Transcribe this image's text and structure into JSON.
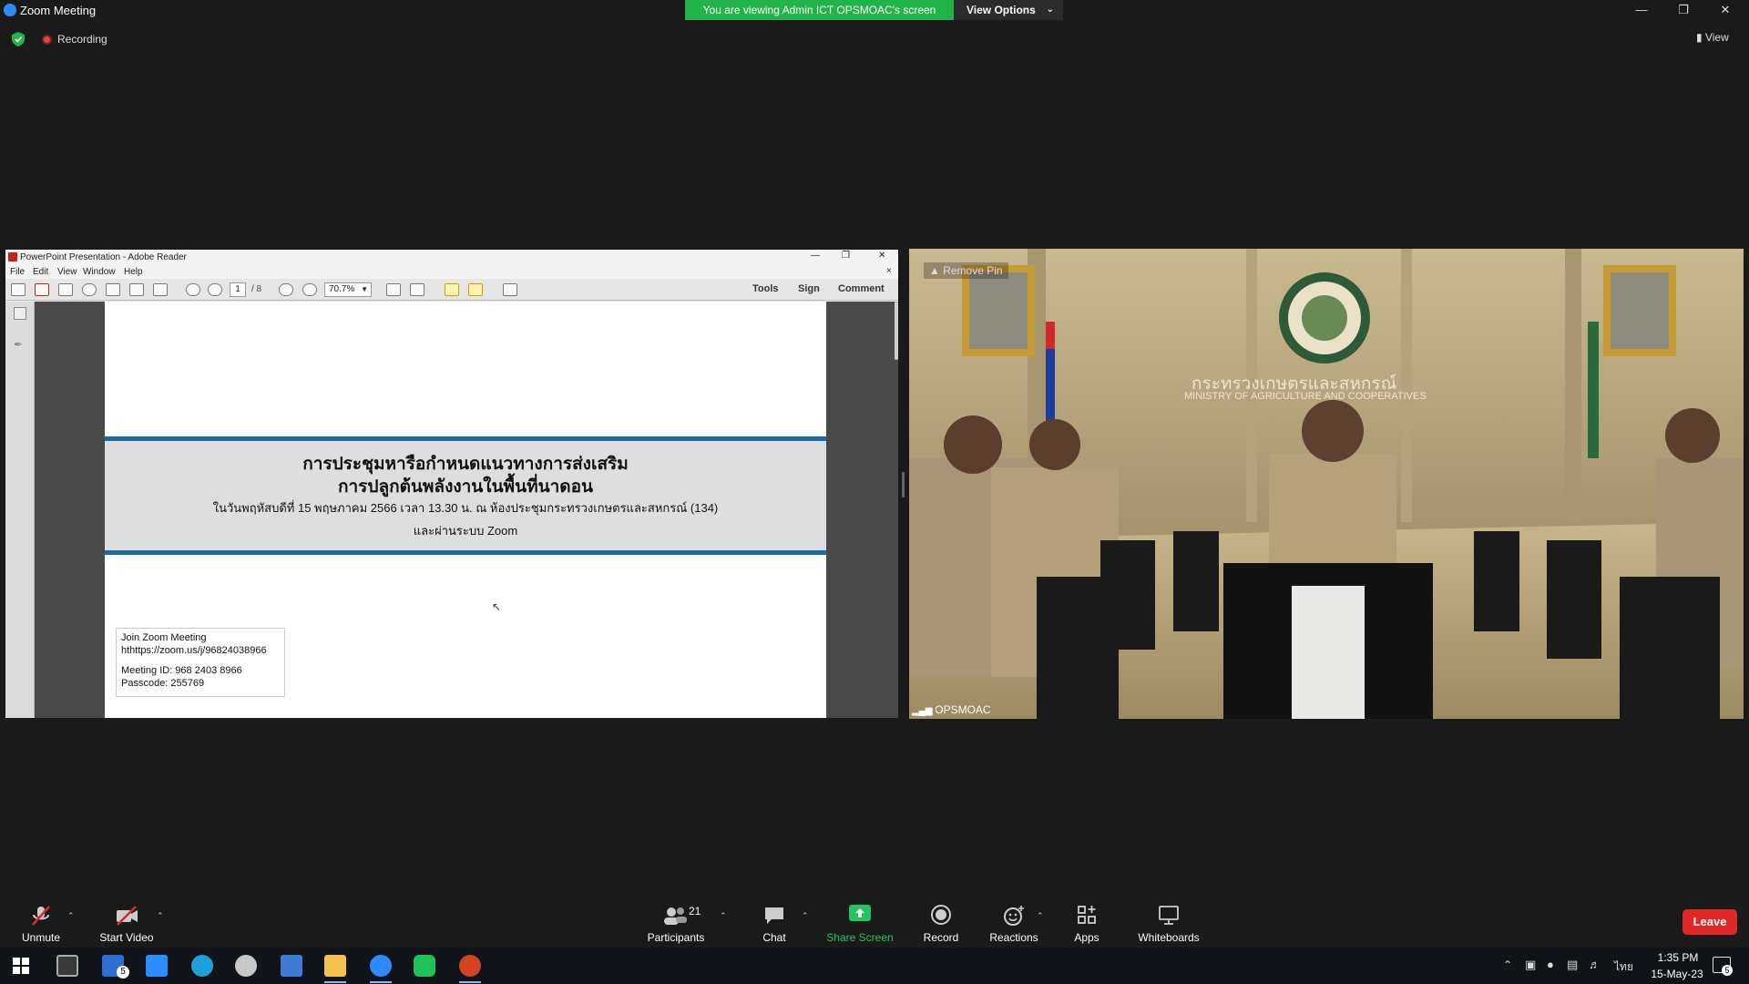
{
  "titlebar": {
    "app_title": "Zoom Meeting",
    "viewing_banner": "You are viewing Admin ICT OPSMOAC's screen",
    "view_options": "View Options"
  },
  "status": {
    "recording": "Recording",
    "view": "View"
  },
  "acrobat": {
    "window_title": "PowerPoint Presentation - Adobe Reader",
    "menu": [
      "File",
      "Edit",
      "View",
      "Window",
      "Help"
    ],
    "page_current": "1",
    "page_total": "/ 8",
    "zoom": "70.7%",
    "tools": "Tools",
    "sign": "Sign",
    "comment": "Comment"
  },
  "slide": {
    "title_line1": "การประชุมหารือกำหนดแนวทางการส่งเสริม",
    "title_line2": "การปลูกต้นพลังงานในพื้นที่นาดอน",
    "subtitle": "ในวันพฤหัสบดีที่ 15 พฤษภาคม 2566 เวลา 13.30 น. ณ ห้องประชุมกระทรวงเกษตรและสหกรณ์ (134)",
    "subtitle2": "และผ่านระบบ Zoom",
    "join_label": "Join Zoom Meeting",
    "join_link": "hthttps://zoom.us/j/96824038966",
    "meeting_id": "Meeting ID: 968 2403 8966",
    "passcode": "Passcode: 255769"
  },
  "video": {
    "participant_name": "OPSMOAC",
    "remove_pin": "Remove Pin",
    "sign_text_th": "กระทรวงเกษตรและสหกรณ์",
    "sign_text_en": "MINISTRY OF AGRICULTURE AND COOPERATIVES"
  },
  "toolbar": {
    "unmute": "Unmute",
    "start_video": "Start Video",
    "participants_count": "21",
    "participants": "Participants",
    "chat": "Chat",
    "share_screen": "Share Screen",
    "record": "Record",
    "reactions": "Reactions",
    "apps": "Apps",
    "whiteboards": "Whiteboards",
    "leave": "Leave"
  },
  "taskbar": {
    "time": "1:35 PM",
    "date": "15-May-23",
    "language": "ไทย",
    "mail_badge": "5",
    "notif_badge": "5"
  },
  "colors": {
    "zoom_blue": "#2d8cff",
    "banner_green": "#22b34b",
    "leave_red": "#e02828",
    "share_green": "#22c55e",
    "slide_blue": "#1a6aa6"
  }
}
